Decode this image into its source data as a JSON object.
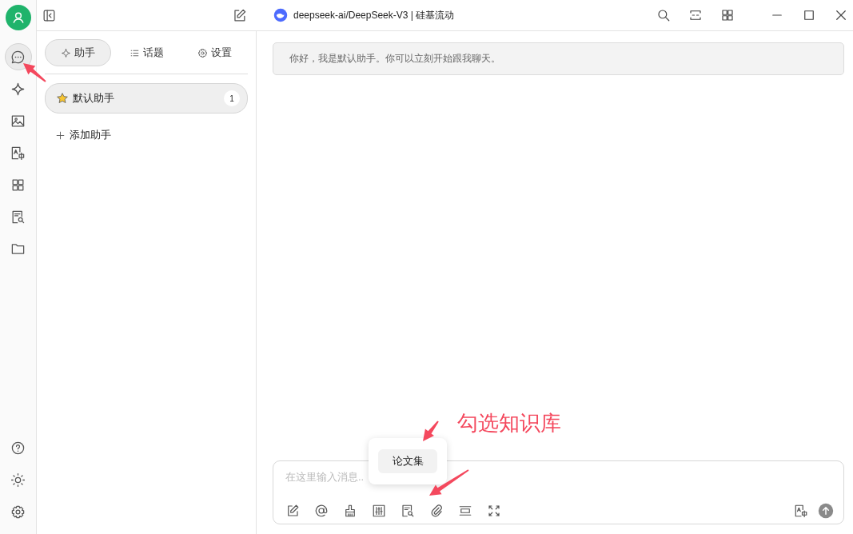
{
  "model_title": "deepseek-ai/DeepSeek-V3 | 硅基流动",
  "rail": [
    {
      "kind": "chat",
      "selected": true
    },
    {
      "kind": "sparkle",
      "selected": false
    },
    {
      "kind": "image",
      "selected": false
    },
    {
      "kind": "translate",
      "selected": false
    },
    {
      "kind": "apps",
      "selected": false
    },
    {
      "kind": "docsearch",
      "selected": false
    },
    {
      "kind": "folder",
      "selected": false
    }
  ],
  "rail_bottom": [
    {
      "kind": "help"
    },
    {
      "kind": "sun"
    },
    {
      "kind": "gear"
    }
  ],
  "tabs": [
    {
      "label": "助手",
      "kind": "sparkle",
      "selected": true
    },
    {
      "label": "话题",
      "kind": "list",
      "selected": false
    },
    {
      "label": "设置",
      "kind": "gear",
      "selected": false
    }
  ],
  "assistants": [
    {
      "name": "默认助手",
      "count": "1",
      "selected": true
    }
  ],
  "add_assistant": "添加助手",
  "greeting": "你好，我是默认助手。你可以立刻开始跟我聊天。",
  "input": {
    "placeholder": "在这里输入消息.."
  },
  "knowledge_popup": {
    "items": [
      "论文集"
    ]
  },
  "annotation": {
    "text": "勾选知识库"
  }
}
